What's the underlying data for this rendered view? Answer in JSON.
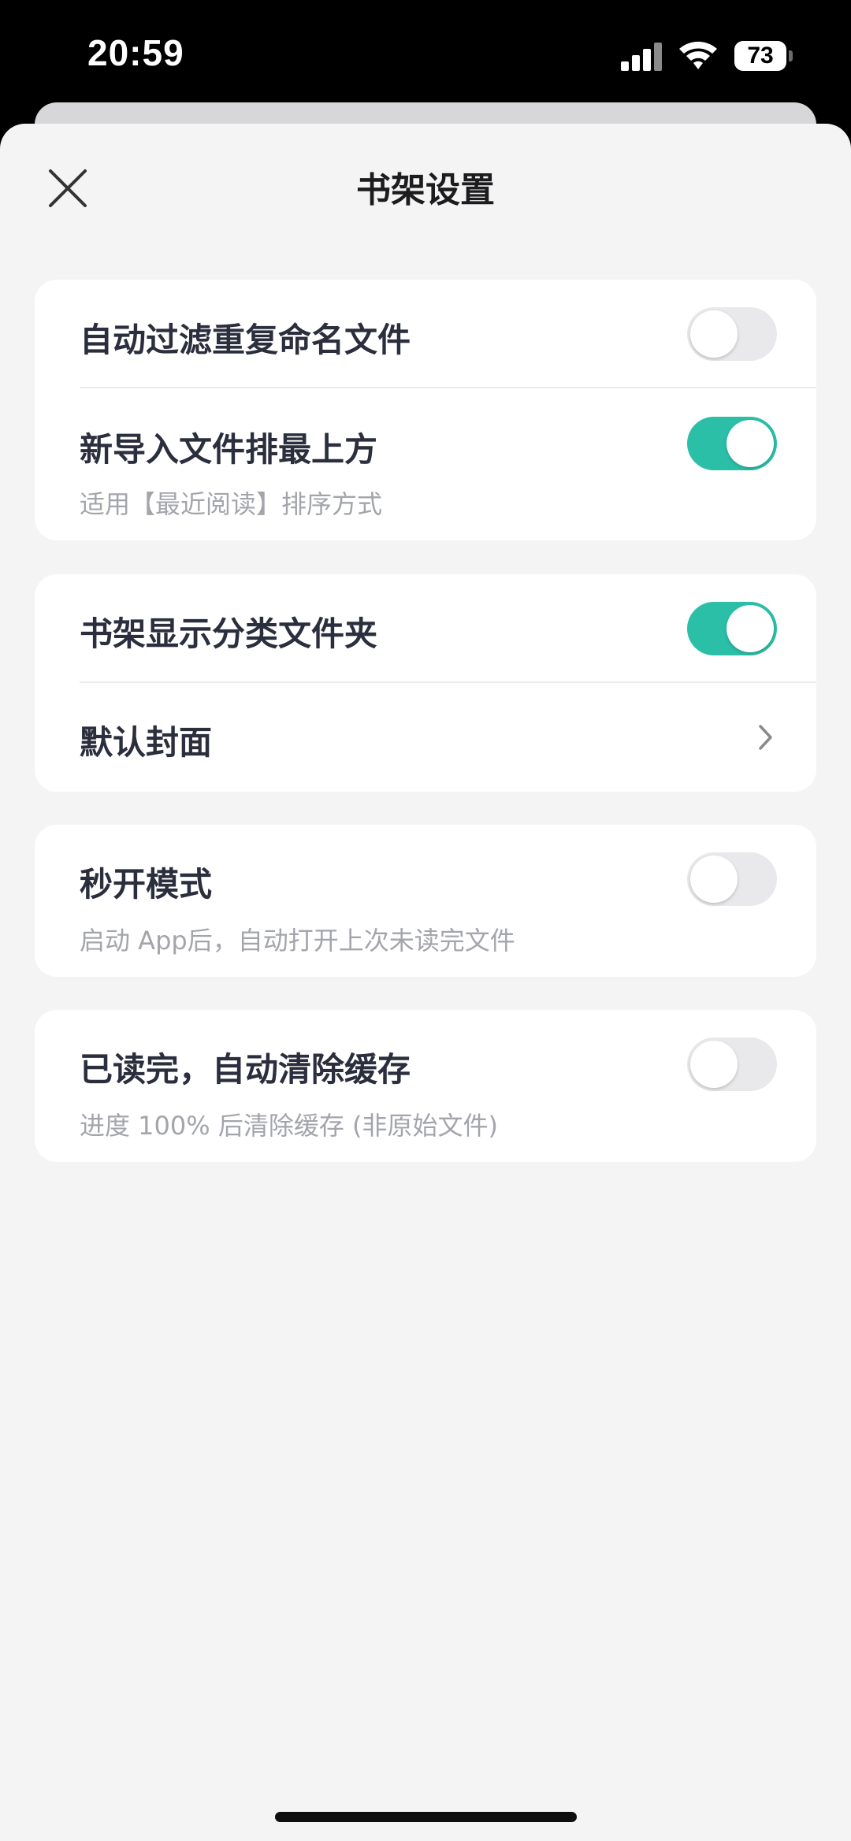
{
  "status_bar": {
    "time": "20:59",
    "battery": "73"
  },
  "header": {
    "title": "书架设置",
    "close_icon": "close-icon"
  },
  "settings": [
    {
      "items": [
        {
          "label": "自动过滤重复命名文件",
          "subtitle": "",
          "control": "toggle",
          "on": false
        },
        {
          "label": "新导入文件排最上方",
          "subtitle": "适用【最近阅读】排序方式",
          "control": "toggle",
          "on": true
        }
      ]
    },
    {
      "items": [
        {
          "label": "书架显示分类文件夹",
          "subtitle": "",
          "control": "toggle",
          "on": true
        },
        {
          "label": "默认封面",
          "subtitle": "",
          "control": "chevron"
        }
      ]
    },
    {
      "items": [
        {
          "label": "秒开模式",
          "subtitle": "启动 App后，自动打开上次未读完文件",
          "control": "toggle",
          "on": false
        }
      ]
    },
    {
      "items": [
        {
          "label": "已读完，自动清除缓存",
          "subtitle": "进度 100% 后清除缓存 (非原始文件)",
          "control": "toggle",
          "on": false
        }
      ]
    }
  ],
  "colors": {
    "accent": "#2cbfa8",
    "toggle_off": "#e9e9eb",
    "background": "#f4f4f4"
  }
}
